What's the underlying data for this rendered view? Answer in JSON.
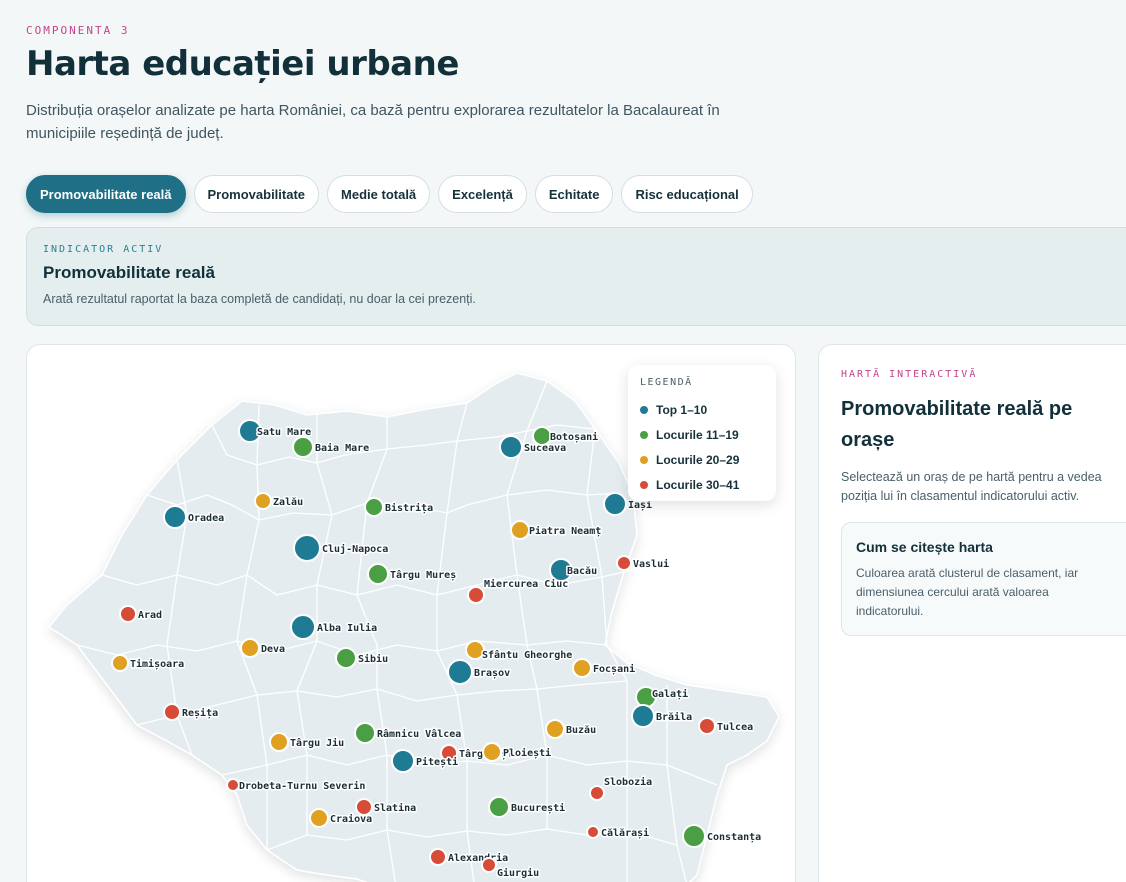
{
  "header": {
    "eyebrow": "COMPONENTA 3",
    "title": "Harta educației urbane",
    "subtitle": "Distribuția orașelor analizate pe harta României, ca bază pentru explorarea rezultatelor la Bacalaureat în municipiile reședință de județ."
  },
  "tabs": [
    {
      "label": "Promovabilitate reală",
      "active": true
    },
    {
      "label": "Promovabilitate",
      "active": false
    },
    {
      "label": "Medie totală",
      "active": false
    },
    {
      "label": "Excelență",
      "active": false
    },
    {
      "label": "Echitate",
      "active": false
    },
    {
      "label": "Risc educațional",
      "active": false
    }
  ],
  "indicator": {
    "eyebrow": "INDICATOR ACTIV",
    "title": "Promovabilitate reală",
    "description": "Arată rezultatul raportat la baza completă de candidați, nu doar la cei prezenți."
  },
  "legend": {
    "title": "LEGENDĂ",
    "items": [
      {
        "label": "Top 1–10",
        "color": "#1f7a93"
      },
      {
        "label": "Locurile 11–19",
        "color": "#4a9e44"
      },
      {
        "label": "Locurile 20–29",
        "color": "#e0a021"
      },
      {
        "label": "Locurile 30–41",
        "color": "#d64c37"
      }
    ]
  },
  "info": {
    "eyebrow": "HARTĂ INTERACTIVĂ",
    "title": "Promovabilitate reală pe orașe",
    "description": "Selectează un oraș de pe hartă pentru a vedea poziția lui în clasamentul indicatorului activ.",
    "read_title": "Cum se citește harta",
    "read_description": "Culoarea arată clusterul de clasament, iar dimensiunea cercului arată valoarea indicatorului."
  },
  "cities": [
    {
      "name": "Satu Mare",
      "cluster": 0
    },
    {
      "name": "Baia Mare",
      "cluster": 1
    },
    {
      "name": "Suceava",
      "cluster": 0
    },
    {
      "name": "Botoșani",
      "cluster": 1
    },
    {
      "name": "Zalău",
      "cluster": 2
    },
    {
      "name": "Bistrița",
      "cluster": 1
    },
    {
      "name": "Iași",
      "cluster": 0
    },
    {
      "name": "Oradea",
      "cluster": 0
    },
    {
      "name": "Piatra Neamț",
      "cluster": 2
    },
    {
      "name": "Cluj-Napoca",
      "cluster": 0
    },
    {
      "name": "Vaslui",
      "cluster": 3
    },
    {
      "name": "Bacău",
      "cluster": 0
    },
    {
      "name": "Târgu Mureș",
      "cluster": 1
    },
    {
      "name": "Miercurea Ciuc",
      "cluster": 3
    },
    {
      "name": "Arad",
      "cluster": 3
    },
    {
      "name": "Alba Iulia",
      "cluster": 0
    },
    {
      "name": "Deva",
      "cluster": 2
    },
    {
      "name": "Sfântu Gheorghe",
      "cluster": 2
    },
    {
      "name": "Timișoara",
      "cluster": 2
    },
    {
      "name": "Sibiu",
      "cluster": 1
    },
    {
      "name": "Brașov",
      "cluster": 0
    },
    {
      "name": "Focșani",
      "cluster": 2
    },
    {
      "name": "Galați",
      "cluster": 1
    },
    {
      "name": "Reșița",
      "cluster": 3
    },
    {
      "name": "Brăila",
      "cluster": 0
    },
    {
      "name": "Tulcea",
      "cluster": 3
    },
    {
      "name": "Râmnicu Vâlcea",
      "cluster": 1
    },
    {
      "name": "Buzău",
      "cluster": 2
    },
    {
      "name": "Târgu Jiu",
      "cluster": 2
    },
    {
      "name": "Târgoviște",
      "cluster": 3
    },
    {
      "name": "Ploiești",
      "cluster": 2
    },
    {
      "name": "Pitești",
      "cluster": 0
    },
    {
      "name": "Drobeta-Turnu Severin",
      "cluster": 3
    },
    {
      "name": "Slobozia",
      "cluster": 3
    },
    {
      "name": "Slatina",
      "cluster": 3
    },
    {
      "name": "București",
      "cluster": 1
    },
    {
      "name": "Craiova",
      "cluster": 2
    },
    {
      "name": "Călărași",
      "cluster": 3
    },
    {
      "name": "Constanța",
      "cluster": 1
    },
    {
      "name": "Alexandria",
      "cluster": 3
    },
    {
      "name": "Giurgiu",
      "cluster": 3
    }
  ]
}
